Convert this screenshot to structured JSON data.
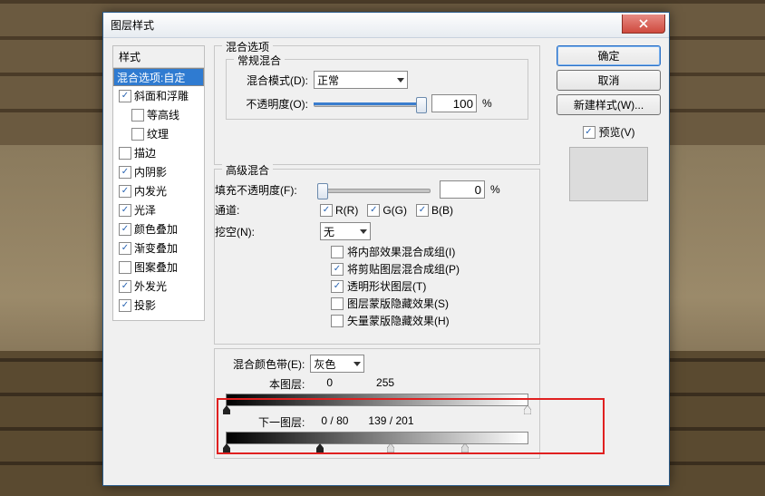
{
  "window": {
    "title": "图层样式"
  },
  "styles": {
    "header": "样式",
    "items": [
      {
        "label": "混合选项:自定",
        "selected": true,
        "checkbox": false,
        "indent": false,
        "checked": false
      },
      {
        "label": "斜面和浮雕",
        "selected": false,
        "checkbox": true,
        "indent": false,
        "checked": true
      },
      {
        "label": "等高线",
        "selected": false,
        "checkbox": true,
        "indent": true,
        "checked": false
      },
      {
        "label": "纹理",
        "selected": false,
        "checkbox": true,
        "indent": true,
        "checked": false
      },
      {
        "label": "描边",
        "selected": false,
        "checkbox": true,
        "indent": false,
        "checked": false
      },
      {
        "label": "内阴影",
        "selected": false,
        "checkbox": true,
        "indent": false,
        "checked": true
      },
      {
        "label": "内发光",
        "selected": false,
        "checkbox": true,
        "indent": false,
        "checked": true
      },
      {
        "label": "光泽",
        "selected": false,
        "checkbox": true,
        "indent": false,
        "checked": true
      },
      {
        "label": "颜色叠加",
        "selected": false,
        "checkbox": true,
        "indent": false,
        "checked": true
      },
      {
        "label": "渐变叠加",
        "selected": false,
        "checkbox": true,
        "indent": false,
        "checked": true
      },
      {
        "label": "图案叠加",
        "selected": false,
        "checkbox": true,
        "indent": false,
        "checked": false
      },
      {
        "label": "外发光",
        "selected": false,
        "checkbox": true,
        "indent": false,
        "checked": true
      },
      {
        "label": "投影",
        "selected": false,
        "checkbox": true,
        "indent": false,
        "checked": true
      }
    ]
  },
  "blending": {
    "title": "混合选项",
    "normal_group": "常规混合",
    "mode_label": "混合模式(D):",
    "mode_value": "正常",
    "opacity_label": "不透明度(O):",
    "opacity_value": "100",
    "pct": "%"
  },
  "advanced": {
    "title": "高级混合",
    "fill_label": "填充不透明度(F):",
    "fill_value": "0",
    "channel_label": "通道:",
    "ch_r": "R(R)",
    "ch_g": "G(G)",
    "ch_b": "B(B)",
    "knockout_label": "挖空(N):",
    "knockout_value": "无",
    "opts": [
      {
        "label": "将内部效果混合成组(I)",
        "checked": false
      },
      {
        "label": "将剪贴图层混合成组(P)",
        "checked": true
      },
      {
        "label": "透明形状图层(T)",
        "checked": true
      },
      {
        "label": "图层蒙版隐藏效果(S)",
        "checked": false
      },
      {
        "label": "矢量蒙版隐藏效果(H)",
        "checked": false
      }
    ]
  },
  "blendif": {
    "label": "混合颜色带(E):",
    "value": "灰色",
    "this_label": "本图层:",
    "this_v0": "0",
    "this_v1": "255",
    "under_label": "下一图层:",
    "under_v0": "0",
    "under_v1": "80",
    "under_v2": "139",
    "under_v3": "201",
    "sep": "/"
  },
  "actions": {
    "ok": "确定",
    "cancel": "取消",
    "newstyle": "新建样式(W)...",
    "preview": "预览(V)"
  }
}
